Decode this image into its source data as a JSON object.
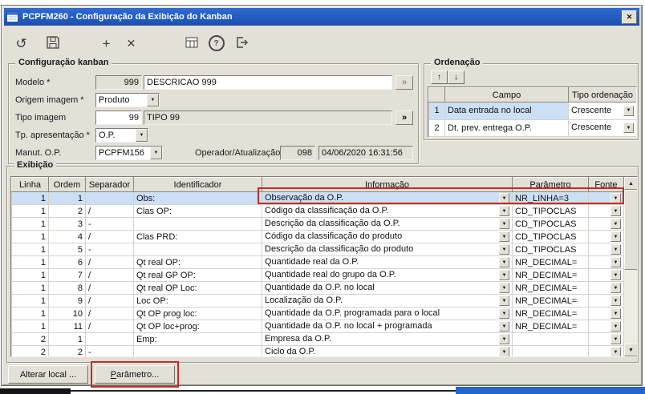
{
  "window": {
    "title": "PCPFM260 - Configuração da Exibição do Kanban"
  },
  "glyphs": {
    "close": "✕",
    "undo": "↺",
    "add": "+",
    "delete": "✕",
    "help": "?",
    "more": "»",
    "combo": "▼",
    "scroll_up": "▲",
    "scroll_down": "▼",
    "move_up": "↑",
    "move_down": "↓"
  },
  "config": {
    "group_title": "Configuração kanban",
    "modelo_label": "Modelo *",
    "modelo_code": "999",
    "modelo_desc": "DESCRICAO 999",
    "origem_label": "Origem imagem *",
    "origem_value": "Produto",
    "tipo_label": "Tipo imagem",
    "tipo_code": "99",
    "tipo_desc": "TIPO 99",
    "tp_label": "Tp. apresentação *",
    "tp_value": "O.P.",
    "manut_label": "Manut. O.P.",
    "manut_value": "PCPFM156",
    "operador_label": "Operador/Atualização",
    "operador_code": "098",
    "operador_datetime": "04/06/2020 16:31:56"
  },
  "ordenacao": {
    "group_title": "Ordenação",
    "col_campo": "Campo",
    "col_tipo": "Tipo ordenação",
    "rows": [
      {
        "num": "1",
        "campo": "Data entrada no local",
        "tipo": "Crescente"
      },
      {
        "num": "2",
        "campo": "Dt. prev. entrega O.P.",
        "tipo": "Crescente"
      }
    ]
  },
  "exibicao": {
    "group_title": "Exibição",
    "columns": [
      "Linha",
      "Ordem",
      "Separador",
      "Identificador",
      "Informação",
      "Parâmetro",
      "Fonte"
    ],
    "rows": [
      {
        "linha": "1",
        "ordem": "1",
        "sep": "",
        "ident": "Obs:",
        "info": "Observação da O.P.",
        "param": "NR_LINHA=3"
      },
      {
        "linha": "1",
        "ordem": "2",
        "sep": "/",
        "ident": "Clas OP:",
        "info": "Código da classificação da O.P.",
        "param": "CD_TIPOCLAS"
      },
      {
        "linha": "1",
        "ordem": "3",
        "sep": "-",
        "ident": "",
        "info": "Descrição da classificação da O.P.",
        "param": "CD_TIPOCLAS"
      },
      {
        "linha": "1",
        "ordem": "4",
        "sep": "/",
        "ident": "Clas PRD:",
        "info": "Código da classificação do produto",
        "param": "CD_TIPOCLAS"
      },
      {
        "linha": "1",
        "ordem": "5",
        "sep": "-",
        "ident": "",
        "info": "Descrição da classificação do produto",
        "param": "CD_TIPOCLAS"
      },
      {
        "linha": "1",
        "ordem": "6",
        "sep": "/",
        "ident": "Qt real OP:",
        "info": "Quantidade real da O.P.",
        "param": "NR_DECIMAL="
      },
      {
        "linha": "1",
        "ordem": "7",
        "sep": "/",
        "ident": "Qt real GP OP:",
        "info": "Quantidade real do grupo da O.P.",
        "param": "NR_DECIMAL="
      },
      {
        "linha": "1",
        "ordem": "8",
        "sep": "/",
        "ident": "Qt real OP Loc:",
        "info": "Quantidade da O.P. no local",
        "param": "NR_DECIMAL="
      },
      {
        "linha": "1",
        "ordem": "9",
        "sep": "/",
        "ident": "Loc OP:",
        "info": "Localização da O.P.",
        "param": "NR_DECIMAL="
      },
      {
        "linha": "1",
        "ordem": "10",
        "sep": "/",
        "ident": "Qt OP prog loc:",
        "info": "Quantidade da O.P. programada para o local",
        "param": "NR_DECIMAL="
      },
      {
        "linha": "1",
        "ordem": "11",
        "sep": "/",
        "ident": "Qt OP loc+prog:",
        "info": "Quantidade da O.P. no local + programada",
        "param": "NR_DECIMAL="
      },
      {
        "linha": "2",
        "ordem": "1",
        "sep": "",
        "ident": "Emp:",
        "info": "Empresa da O.P.",
        "param": ""
      },
      {
        "linha": "2",
        "ordem": "2",
        "sep": "-",
        "ident": "",
        "info": "Ciclo da O.P.",
        "param": ""
      }
    ]
  },
  "footer": {
    "alterar_local": "Alterar local ...",
    "parametro_mnemonic": "P",
    "parametro_rest": "arâmetro..."
  }
}
